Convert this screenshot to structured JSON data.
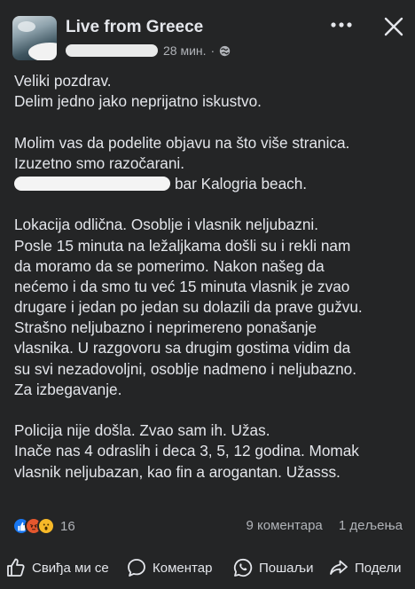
{
  "post": {
    "page_name": "Live from Greece",
    "time": "28 мин.",
    "separator": "·",
    "globe_icon": "globe-icon",
    "lines": {
      "l1": "Veliki pozdrav.",
      "l2": "Delim jedno jako neprijatno iskustvo.",
      "l3": "Molim vas da podelite objavu na što više stranica.",
      "l4": "Izuzetno smo razočarani.",
      "l5": "bar Kalogria beach.",
      "l6": "Lokacija odlična. Osoblje i vlasnik neljubazni.",
      "l7": "Posle 15 minuta na ležaljkama došli su i rekli nam",
      "l8": "da moramo da se pomerimo. Nakon našeg da",
      "l9": "nećemo i da smo tu već 15 minuta vlasnik je zvao",
      "l10": "drugare i jedan po jedan su dolazili da prave gužvu.",
      "l11": "Strašno neljubazno i neprimereno ponašanje",
      "l12": "vlasnika. U razgovoru sa drugim gostima vidim da",
      "l13": "su svi nezadovoljni, osoblje nadmeno i neljubazno.",
      "l14": "Za izbegavanje.",
      "l15": "Policija nije došla. Zvao sam ih. Užas.",
      "l16": "Inače nas 4 odraslih i deca 3, 5, 12 godina. Momak",
      "l17": "vlasnik neljubazan, kao fin a arogantan. Užasss."
    }
  },
  "reactions": {
    "icons": [
      "like-reaction-icon",
      "angry-reaction-icon",
      "wow-reaction-icon"
    ],
    "count": "16",
    "comments": "9 коментара",
    "shares": "1 дељења"
  },
  "actions": {
    "like": "Свиђа ми се",
    "comment": "Коментар",
    "send": "Пошаљи",
    "share": "Подели"
  },
  "colors": {
    "background": "#242526",
    "text": "#e4e6eb",
    "secondary": "#b0b3b8",
    "like_blue": "#1877f2"
  }
}
